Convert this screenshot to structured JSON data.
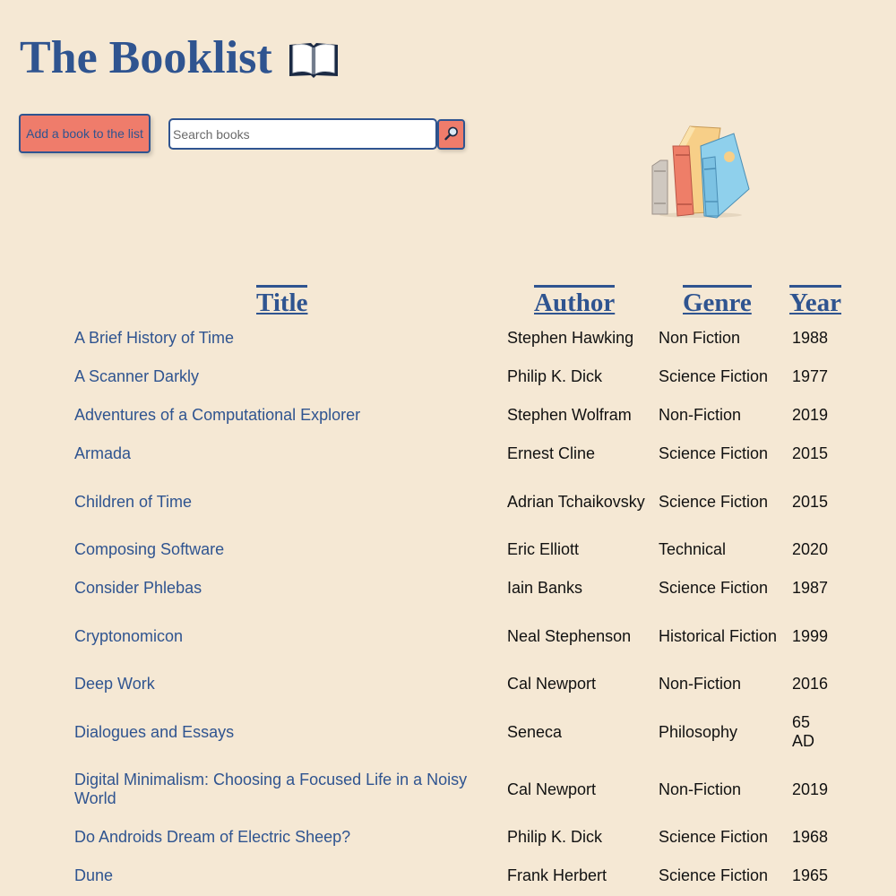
{
  "header": {
    "title": "The Booklist",
    "title_icon": "open-book-icon"
  },
  "toolbar": {
    "add_label": "Add a book to the list",
    "search_placeholder": "Search books",
    "search_value": "",
    "search_icon": "magnifier-icon"
  },
  "illustration": "books-stack-illustration",
  "colors": {
    "background": "#f5e8d4",
    "accent": "#2f5490",
    "button": "#ef7c6b"
  },
  "table": {
    "columns": [
      "Title",
      "Author",
      "Genre",
      "Year"
    ],
    "rows": [
      {
        "title": "A Brief History of Time",
        "author": "Stephen Hawking",
        "genre": "Non Fiction",
        "year": "1988"
      },
      {
        "title": "A Scanner Darkly",
        "author": "Philip K. Dick",
        "genre": "Science Fiction",
        "year": "1977"
      },
      {
        "title": "Adventures of a Computational Explorer",
        "author": "Stephen Wolfram",
        "genre": "Non-Fiction",
        "year": "2019"
      },
      {
        "title": "Armada",
        "author": "Ernest Cline",
        "genre": "Science Fiction",
        "year": "2015"
      },
      {
        "title": "Children of Time",
        "author": "Adrian Tchaikovsky",
        "genre": "Science Fiction",
        "year": "2015"
      },
      {
        "title": "Composing Software",
        "author": "Eric Elliott",
        "genre": "Technical",
        "year": "2020"
      },
      {
        "title": "Consider Phlebas",
        "author": "Iain Banks",
        "genre": "Science Fiction",
        "year": "1987"
      },
      {
        "title": "Cryptonomicon",
        "author": "Neal Stephenson",
        "genre": "Historical Fiction",
        "year": "1999"
      },
      {
        "title": "Deep Work",
        "author": "Cal Newport",
        "genre": "Non-Fiction",
        "year": "2016"
      },
      {
        "title": "Dialogues and Essays",
        "author": "Seneca",
        "genre": "Philosophy",
        "year": "65 AD"
      },
      {
        "title": "Digital Minimalism: Choosing a Focused Life in a Noisy World",
        "author": "Cal Newport",
        "genre": "Non-Fiction",
        "year": "2019"
      },
      {
        "title": "Do Androids Dream of Electric Sheep?",
        "author": "Philip K. Dick",
        "genre": "Science Fiction",
        "year": "1968"
      },
      {
        "title": "Dune",
        "author": "Frank Herbert",
        "genre": "Science Fiction",
        "year": "1965"
      }
    ]
  }
}
